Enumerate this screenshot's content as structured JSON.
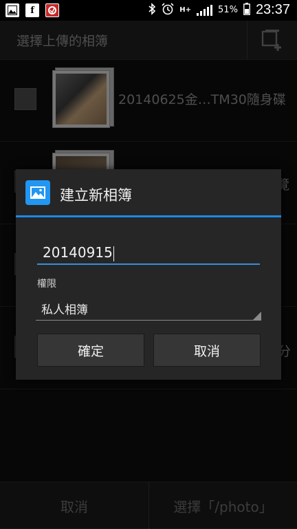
{
  "status_bar": {
    "notif_icons": [
      "gallery-icon",
      "facebook-icon",
      "app-icon"
    ],
    "facebook_glyph": "f",
    "battery": "51%",
    "time": "23:37",
    "network": "H+"
  },
  "header": {
    "title": "選擇上傳的相簿"
  },
  "albums": [
    {
      "name": "20140625金…TM30隨身碟"
    },
    {
      "name": "覽"
    },
    {
      "name": ""
    },
    {
      "name": "分"
    }
  ],
  "dialog": {
    "title": "建立新相簿",
    "album_name_value": "20140915",
    "permission_label": "權限",
    "permission_value": "私人相簿",
    "ok_label": "確定",
    "cancel_label": "取消"
  },
  "bottom_bar": {
    "cancel_label": "取消",
    "select_label": "選擇「/photo」"
  },
  "colors": {
    "accent": "#1e88e5",
    "dialog_bg": "#262626",
    "background": "#0d0d0d"
  }
}
